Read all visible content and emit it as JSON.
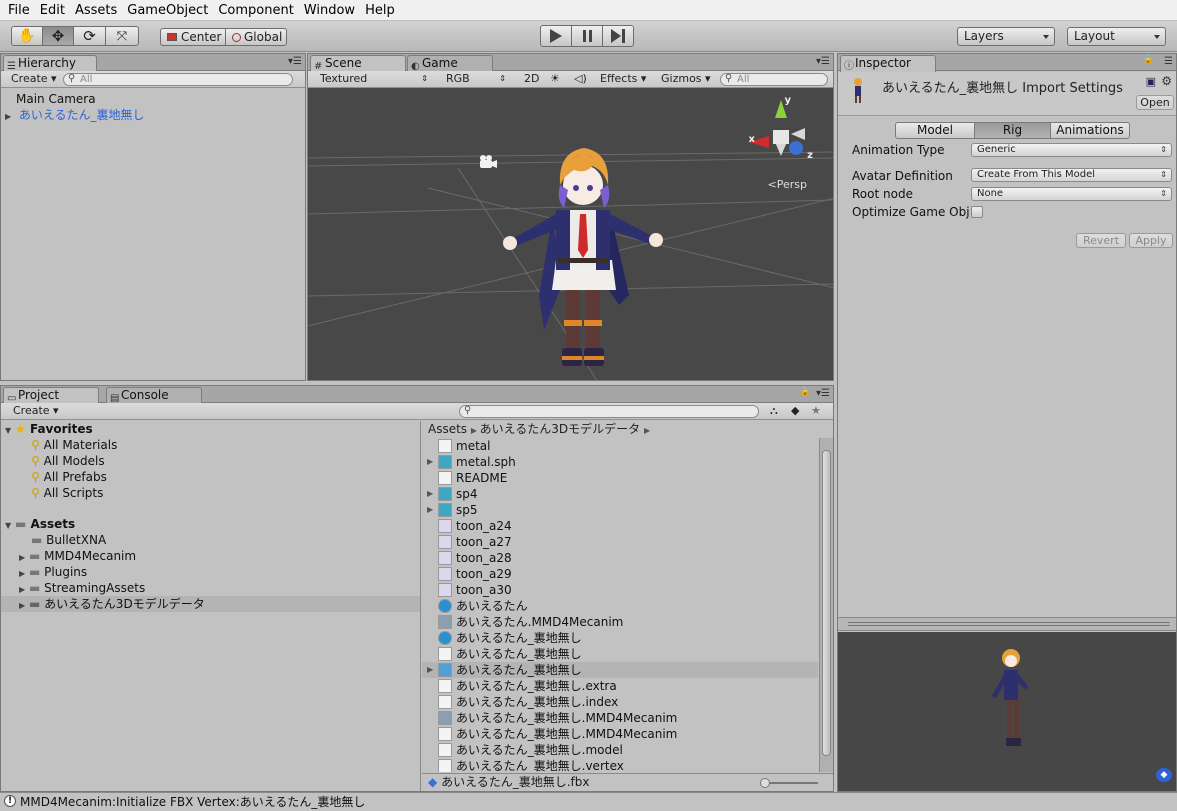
{
  "menu": [
    "File",
    "Edit",
    "Assets",
    "GameObject",
    "Component",
    "Window",
    "Help"
  ],
  "toolbar": {
    "pivot_label": "Center",
    "space_label": "Global",
    "layers_label": "Layers",
    "layout_label": "Layout"
  },
  "hierarchy": {
    "tab": "Hierarchy",
    "create": "Create",
    "search_placeholder": "All",
    "items": [
      {
        "label": "Main Camera",
        "color": "#111111"
      },
      {
        "label": "あいえるたん_裏地無し",
        "color": "#2f62d6"
      }
    ]
  },
  "scene": {
    "tab_scene": "Scene",
    "tab_game": "Game",
    "shading": "Textured",
    "render_mode": "RGB",
    "mode_2d": "2D",
    "effects": "Effects",
    "gizmos": "Gizmos",
    "search_placeholder": "All",
    "persp_label": "Persp",
    "axis_x": "x",
    "axis_y": "y",
    "axis_z": "z"
  },
  "inspector": {
    "tab": "Inspector",
    "title": "あいえるたん_裏地無し Import Settings",
    "open_label": "Open",
    "tabs": [
      "Model",
      "Rig",
      "Animations"
    ],
    "active_tab": "Rig",
    "fields": [
      {
        "label": "Animation Type",
        "value": "Generic"
      },
      {
        "label": "Avatar Definition",
        "value": "Create From This Model"
      },
      {
        "label": "Root node",
        "value": "None"
      },
      {
        "label": "Optimize Game Obje",
        "value": ""
      }
    ],
    "revert_label": "Revert",
    "apply_label": "Apply"
  },
  "project": {
    "tab_project": "Project",
    "tab_console": "Console",
    "create": "Create",
    "favorites_label": "Favorites",
    "favorites": [
      "All Materials",
      "All Models",
      "All Prefabs",
      "All Scripts"
    ],
    "assets_label": "Assets",
    "folders": [
      "BulletXNA",
      "MMD4Mecanim",
      "Plugins",
      "StreamingAssets",
      "あいえるたん3Dモデルデータ"
    ],
    "breadcrumb": [
      "Assets",
      "あいえるたん3Dモデルデータ"
    ],
    "assets": [
      {
        "name": "metal",
        "icon": "file-icon"
      },
      {
        "name": "metal.sph",
        "icon": "prefab-icon"
      },
      {
        "name": "README",
        "icon": "file-icon"
      },
      {
        "name": "sp4",
        "icon": "prefab-icon"
      },
      {
        "name": "sp5",
        "icon": "prefab-icon"
      },
      {
        "name": "toon_a24",
        "icon": "texture-icon"
      },
      {
        "name": "toon_a27",
        "icon": "texture-icon"
      },
      {
        "name": "toon_a28",
        "icon": "texture-icon"
      },
      {
        "name": "toon_a29",
        "icon": "texture-icon"
      },
      {
        "name": "toon_a30",
        "icon": "texture-icon"
      },
      {
        "name": "あいえるたん",
        "icon": "globe-icon"
      },
      {
        "name": "あいえるたん.MMD4Mecanim",
        "icon": "script-icon"
      },
      {
        "name": "あいえるたん_裏地無し",
        "icon": "globe-icon"
      },
      {
        "name": "あいえるたん_裏地無し",
        "icon": "file-icon"
      },
      {
        "name": "あいえるたん_裏地無し",
        "icon": "model-icon"
      },
      {
        "name": "あいえるたん_裏地無し.extra",
        "icon": "file-icon"
      },
      {
        "name": "あいえるたん_裏地無し.index",
        "icon": "file-icon"
      },
      {
        "name": "あいえるたん_裏地無し.MMD4Mecanim",
        "icon": "script-icon"
      },
      {
        "name": "あいえるたん_裏地無し.MMD4Mecanim",
        "icon": "file-icon"
      },
      {
        "name": "あいえるたん_裏地無し.model",
        "icon": "file-icon"
      },
      {
        "name": "あいえるたん_裏地無し.vertex",
        "icon": "file-icon"
      }
    ],
    "selected_file": "あいえるたん_裏地無し.fbx"
  },
  "status": {
    "message": "MMD4Mecanim:Initialize FBX Vertex:あいえるたん_裏地無し"
  }
}
